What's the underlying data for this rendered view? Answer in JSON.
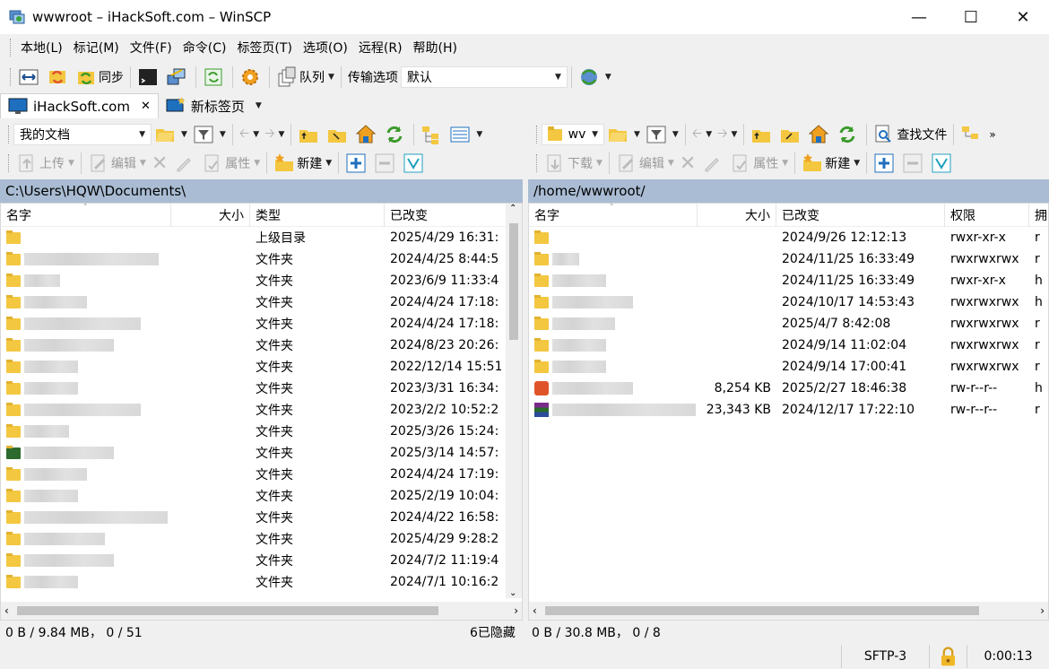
{
  "window": {
    "title": "wwwroot – iHackSoft.com – WinSCP"
  },
  "menu": [
    "本地(L)",
    "标记(M)",
    "文件(F)",
    "命令(C)",
    "标签页(T)",
    "选项(O)",
    "远程(R)",
    "帮助(H)"
  ],
  "toolbar": {
    "sync_label": "同步",
    "queue_label": "队列",
    "transfer_options_label": "传输选项",
    "transfer_options_value": "默认"
  },
  "tabs": {
    "active": "iHackSoft.com",
    "new_tab": "新标签页"
  },
  "left": {
    "location_combo": "我的文档",
    "upload": "上传",
    "edit": "编辑",
    "properties": "属性",
    "new": "新建",
    "path": "C:\\Users\\HQW\\Documents\\",
    "columns": [
      "名字",
      "大小",
      "类型",
      "已改变"
    ],
    "rows": [
      {
        "name": "",
        "size": "",
        "type": "上级目录",
        "changed": "2025/4/29 16:31:"
      },
      {
        "name": "",
        "size": "",
        "type": "文件夹",
        "changed": "2024/4/25 8:44:5"
      },
      {
        "name": "",
        "size": "",
        "type": "文件夹",
        "changed": "2023/6/9 11:33:4"
      },
      {
        "name": "",
        "size": "",
        "type": "文件夹",
        "changed": "2024/4/24 17:18:"
      },
      {
        "name": "",
        "size": "",
        "type": "文件夹",
        "changed": "2024/4/24 17:18:"
      },
      {
        "name": "",
        "size": "",
        "type": "文件夹",
        "changed": "2024/8/23 20:26:"
      },
      {
        "name": "",
        "size": "",
        "type": "文件夹",
        "changed": "2022/12/14 15:51"
      },
      {
        "name": "",
        "size": "",
        "type": "文件夹",
        "changed": "2023/3/31 16:34:"
      },
      {
        "name": "",
        "size": "",
        "type": "文件夹",
        "changed": "2023/2/2 10:52:2"
      },
      {
        "name": "",
        "size": "",
        "type": "文件夹",
        "changed": "2025/3/26 15:24:"
      },
      {
        "name": "",
        "size": "",
        "type": "文件夹",
        "changed": "2025/3/14 14:57:"
      },
      {
        "name": "",
        "size": "",
        "type": "文件夹",
        "changed": "2024/4/24 17:19:"
      },
      {
        "name": "",
        "size": "",
        "type": "文件夹",
        "changed": "2025/2/19 10:04:"
      },
      {
        "name": "",
        "size": "",
        "type": "文件夹",
        "changed": "2024/4/22 16:58:"
      },
      {
        "name": "",
        "size": "",
        "type": "文件夹",
        "changed": "2025/4/29 9:28:2"
      },
      {
        "name": "",
        "size": "",
        "type": "文件夹",
        "changed": "2024/7/2 11:19:4"
      },
      {
        "name": "",
        "size": "",
        "type": "文件夹",
        "changed": "2024/7/1 10:16:2"
      }
    ],
    "status_left": "0 B / 9.84 MB， 0 / 51",
    "status_right": "6已隐藏"
  },
  "right": {
    "location_combo": "wv",
    "find_files": "查找文件",
    "download": "下载",
    "edit": "编辑",
    "properties": "属性",
    "new": "新建",
    "path": "/home/wwwroot/",
    "columns": [
      "名字",
      "大小",
      "已改变",
      "权限",
      "拥"
    ],
    "rows": [
      {
        "name": "",
        "size": "",
        "changed": "2024/9/26 12:12:13",
        "rights": "rwxr-xr-x",
        "owner": "r"
      },
      {
        "name": "",
        "size": "",
        "changed": "2024/11/25 16:33:49",
        "rights": "rwxrwxrwx",
        "owner": "r"
      },
      {
        "name": "",
        "size": "",
        "changed": "2024/11/25 16:33:49",
        "rights": "rwxr-xr-x",
        "owner": "h"
      },
      {
        "name": "",
        "size": "",
        "changed": "2024/10/17 14:53:43",
        "rights": "rwxrwxrwx",
        "owner": "h"
      },
      {
        "name": "",
        "size": "",
        "changed": "2025/4/7 8:42:08",
        "rights": "rwxrwxrwx",
        "owner": "r"
      },
      {
        "name": "",
        "size": "",
        "changed": "2024/9/14 11:02:04",
        "rights": "rwxrwxrwx",
        "owner": "r"
      },
      {
        "name": "",
        "size": "",
        "changed": "2024/9/14 17:00:41",
        "rights": "rwxrwxrwx",
        "owner": "r"
      },
      {
        "name": "",
        "size": "8,254 KB",
        "changed": "2025/2/27 18:46:38",
        "rights": "rw-r--r--",
        "owner": "h"
      },
      {
        "name": "",
        "size": "23,343 KB",
        "changed": "2024/12/17 17:22:10",
        "rights": "rw-r--r--",
        "owner": "r"
      }
    ],
    "status_left": "0 B / 30.8 MB， 0 / 8"
  },
  "statusbar": {
    "protocol": "SFTP-3",
    "timer": "0:00:13"
  }
}
